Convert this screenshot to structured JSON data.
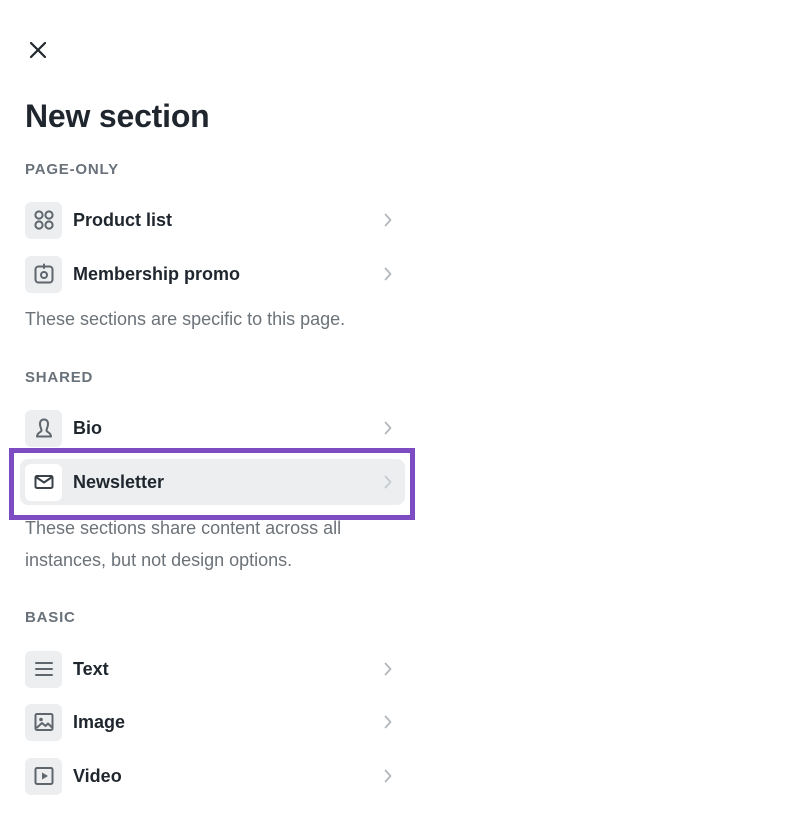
{
  "header": {
    "title": "New section",
    "close_icon": "close-icon"
  },
  "groups": [
    {
      "label": "PAGE-ONLY",
      "items": [
        {
          "label": "Product list",
          "icon": "grid-icon"
        },
        {
          "label": "Membership promo",
          "icon": "membership-icon"
        }
      ],
      "note": "These sections are specific to this page."
    },
    {
      "label": "SHARED",
      "items": [
        {
          "label": "Bio",
          "icon": "person-icon"
        },
        {
          "label": "Newsletter",
          "icon": "mail-icon",
          "highlighted": true
        }
      ],
      "note": "These sections share content across all instances, but not design options."
    },
    {
      "label": "BASIC",
      "items": [
        {
          "label": "Text",
          "icon": "text-lines-icon"
        },
        {
          "label": "Image",
          "icon": "image-icon"
        },
        {
          "label": "Video",
          "icon": "video-icon"
        }
      ]
    }
  ],
  "colors": {
    "highlight_ring": "#7d4cc2",
    "icon_bg": "#eceef0",
    "text_primary": "#1f262d",
    "text_muted": "#6b7278"
  }
}
